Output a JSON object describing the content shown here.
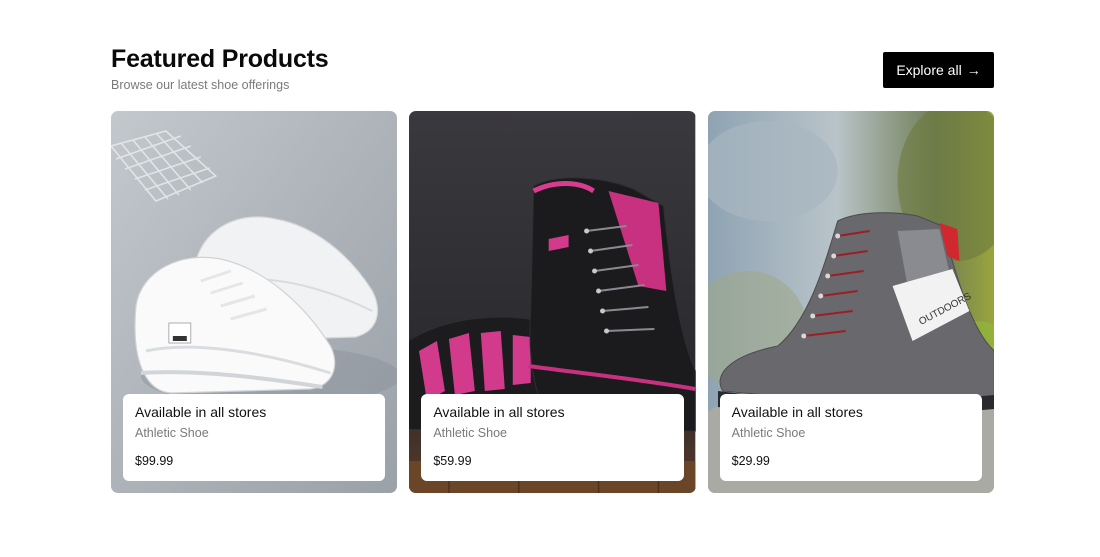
{
  "header": {
    "title": "Featured Products",
    "subtitle": "Browse our latest shoe offerings",
    "explore_label": "Explore all",
    "explore_icon": "arrow-right-icon"
  },
  "products": [
    {
      "availability": "Available in all stores",
      "category": "Athletic Shoe",
      "price": "$99.99",
      "image": "white-sneakers",
      "bg_color": "#aab1b8"
    },
    {
      "availability": "Available in all stores",
      "category": "Athletic Shoe",
      "price": "$59.99",
      "image": "black-pink-hiking-boots",
      "bg_color": "#2e2d31"
    },
    {
      "availability": "Available in all stores",
      "category": "Athletic Shoe",
      "price": "$29.99",
      "image": "grey-outdoor-boot",
      "bg_color": "#7f8a86"
    }
  ]
}
